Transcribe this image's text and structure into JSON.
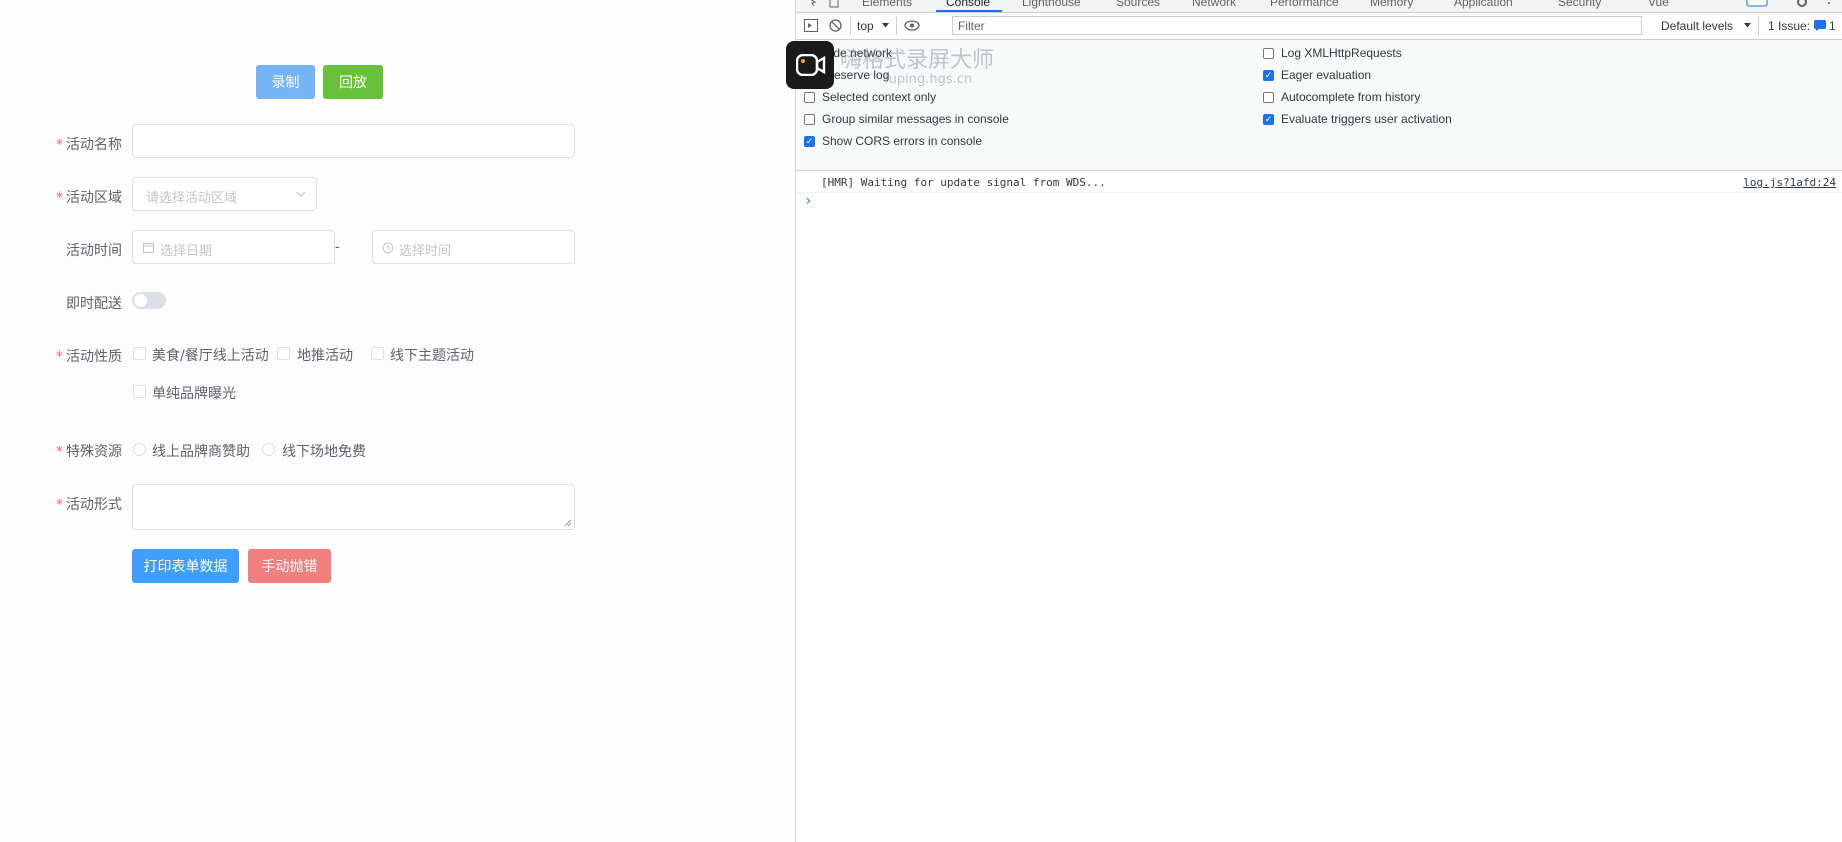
{
  "form": {
    "record_label": "录制",
    "replay_label": "回放",
    "fields": {
      "name_label": "活动名称",
      "region_label": "活动区域",
      "region_placeholder": "请选择活动区域",
      "time_label": "活动时间",
      "date_placeholder": "选择日期",
      "date_separator": "-",
      "time_placeholder": "选择时间",
      "delivery_label": "即时配送",
      "nature_label": "活动性质",
      "nature_options": [
        "美食/餐厅线上活动",
        "地推活动",
        "线下主题活动",
        "单纯品牌曝光"
      ],
      "resource_label": "特殊资源",
      "resource_options": [
        "线上品牌商赞助",
        "线下场地免费"
      ],
      "form_label": "活动形式"
    },
    "required_mark": "*",
    "print_label": "打印表单数据",
    "throw_label": "手动抛错"
  },
  "devtools": {
    "tabs": [
      "Elements",
      "Console",
      "Lighthouse",
      "Sources",
      "Network",
      "Performance",
      "Memory",
      "Application",
      "Security",
      "Vue"
    ],
    "active_tab": "Console",
    "context": "top",
    "filter_placeholder": "Filter",
    "levels": "Default levels",
    "issues": "1 Issue:",
    "issues_count": "1",
    "settings_left": [
      {
        "label": "Hide network",
        "checked": false
      },
      {
        "label": "Preserve log",
        "checked": false
      },
      {
        "label": "Selected context only",
        "checked": false
      },
      {
        "label": "Group similar messages in console",
        "checked": false
      },
      {
        "label": "Show CORS errors in console",
        "checked": true
      }
    ],
    "settings_right": [
      {
        "label": "Log XMLHttpRequests",
        "checked": false
      },
      {
        "label": "Eager evaluation",
        "checked": true
      },
      {
        "label": "Autocomplete from history",
        "checked": false
      },
      {
        "label": "Evaluate triggers user activation",
        "checked": true
      }
    ],
    "console_message": "[HMR] Waiting for update signal from WDS...",
    "console_source": "log.js?1afd:24",
    "prompt": "›"
  },
  "watermark": {
    "title": "嗨格式录屏大师",
    "url": "luping.hgs.cn"
  }
}
